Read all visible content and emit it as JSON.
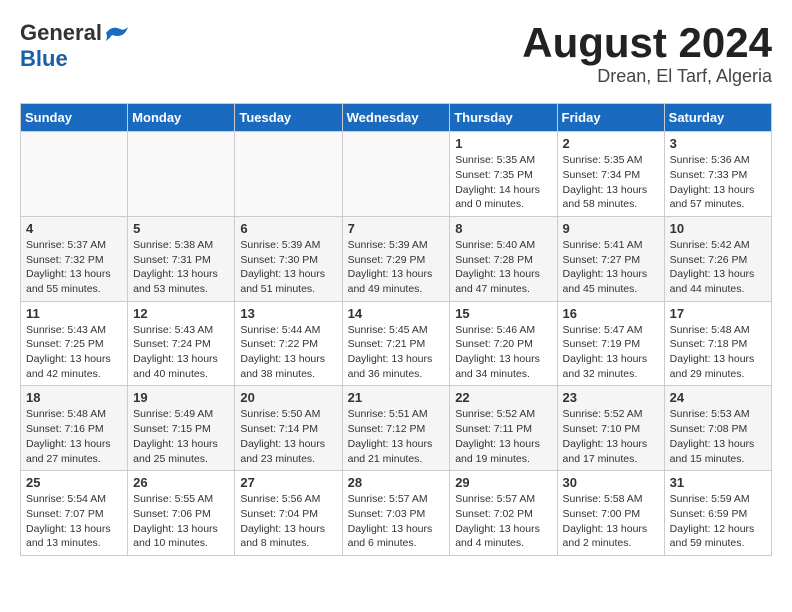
{
  "header": {
    "logo_general": "General",
    "logo_blue": "Blue",
    "month_title": "August 2024",
    "location": "Drean, El Tarf, Algeria"
  },
  "calendar": {
    "days_of_week": [
      "Sunday",
      "Monday",
      "Tuesday",
      "Wednesday",
      "Thursday",
      "Friday",
      "Saturday"
    ],
    "weeks": [
      [
        {
          "day": "",
          "info": ""
        },
        {
          "day": "",
          "info": ""
        },
        {
          "day": "",
          "info": ""
        },
        {
          "day": "",
          "info": ""
        },
        {
          "day": "1",
          "info": "Sunrise: 5:35 AM\nSunset: 7:35 PM\nDaylight: 14 hours\nand 0 minutes."
        },
        {
          "day": "2",
          "info": "Sunrise: 5:35 AM\nSunset: 7:34 PM\nDaylight: 13 hours\nand 58 minutes."
        },
        {
          "day": "3",
          "info": "Sunrise: 5:36 AM\nSunset: 7:33 PM\nDaylight: 13 hours\nand 57 minutes."
        }
      ],
      [
        {
          "day": "4",
          "info": "Sunrise: 5:37 AM\nSunset: 7:32 PM\nDaylight: 13 hours\nand 55 minutes."
        },
        {
          "day": "5",
          "info": "Sunrise: 5:38 AM\nSunset: 7:31 PM\nDaylight: 13 hours\nand 53 minutes."
        },
        {
          "day": "6",
          "info": "Sunrise: 5:39 AM\nSunset: 7:30 PM\nDaylight: 13 hours\nand 51 minutes."
        },
        {
          "day": "7",
          "info": "Sunrise: 5:39 AM\nSunset: 7:29 PM\nDaylight: 13 hours\nand 49 minutes."
        },
        {
          "day": "8",
          "info": "Sunrise: 5:40 AM\nSunset: 7:28 PM\nDaylight: 13 hours\nand 47 minutes."
        },
        {
          "day": "9",
          "info": "Sunrise: 5:41 AM\nSunset: 7:27 PM\nDaylight: 13 hours\nand 45 minutes."
        },
        {
          "day": "10",
          "info": "Sunrise: 5:42 AM\nSunset: 7:26 PM\nDaylight: 13 hours\nand 44 minutes."
        }
      ],
      [
        {
          "day": "11",
          "info": "Sunrise: 5:43 AM\nSunset: 7:25 PM\nDaylight: 13 hours\nand 42 minutes."
        },
        {
          "day": "12",
          "info": "Sunrise: 5:43 AM\nSunset: 7:24 PM\nDaylight: 13 hours\nand 40 minutes."
        },
        {
          "day": "13",
          "info": "Sunrise: 5:44 AM\nSunset: 7:22 PM\nDaylight: 13 hours\nand 38 minutes."
        },
        {
          "day": "14",
          "info": "Sunrise: 5:45 AM\nSunset: 7:21 PM\nDaylight: 13 hours\nand 36 minutes."
        },
        {
          "day": "15",
          "info": "Sunrise: 5:46 AM\nSunset: 7:20 PM\nDaylight: 13 hours\nand 34 minutes."
        },
        {
          "day": "16",
          "info": "Sunrise: 5:47 AM\nSunset: 7:19 PM\nDaylight: 13 hours\nand 32 minutes."
        },
        {
          "day": "17",
          "info": "Sunrise: 5:48 AM\nSunset: 7:18 PM\nDaylight: 13 hours\nand 29 minutes."
        }
      ],
      [
        {
          "day": "18",
          "info": "Sunrise: 5:48 AM\nSunset: 7:16 PM\nDaylight: 13 hours\nand 27 minutes."
        },
        {
          "day": "19",
          "info": "Sunrise: 5:49 AM\nSunset: 7:15 PM\nDaylight: 13 hours\nand 25 minutes."
        },
        {
          "day": "20",
          "info": "Sunrise: 5:50 AM\nSunset: 7:14 PM\nDaylight: 13 hours\nand 23 minutes."
        },
        {
          "day": "21",
          "info": "Sunrise: 5:51 AM\nSunset: 7:12 PM\nDaylight: 13 hours\nand 21 minutes."
        },
        {
          "day": "22",
          "info": "Sunrise: 5:52 AM\nSunset: 7:11 PM\nDaylight: 13 hours\nand 19 minutes."
        },
        {
          "day": "23",
          "info": "Sunrise: 5:52 AM\nSunset: 7:10 PM\nDaylight: 13 hours\nand 17 minutes."
        },
        {
          "day": "24",
          "info": "Sunrise: 5:53 AM\nSunset: 7:08 PM\nDaylight: 13 hours\nand 15 minutes."
        }
      ],
      [
        {
          "day": "25",
          "info": "Sunrise: 5:54 AM\nSunset: 7:07 PM\nDaylight: 13 hours\nand 13 minutes."
        },
        {
          "day": "26",
          "info": "Sunrise: 5:55 AM\nSunset: 7:06 PM\nDaylight: 13 hours\nand 10 minutes."
        },
        {
          "day": "27",
          "info": "Sunrise: 5:56 AM\nSunset: 7:04 PM\nDaylight: 13 hours\nand 8 minutes."
        },
        {
          "day": "28",
          "info": "Sunrise: 5:57 AM\nSunset: 7:03 PM\nDaylight: 13 hours\nand 6 minutes."
        },
        {
          "day": "29",
          "info": "Sunrise: 5:57 AM\nSunset: 7:02 PM\nDaylight: 13 hours\nand 4 minutes."
        },
        {
          "day": "30",
          "info": "Sunrise: 5:58 AM\nSunset: 7:00 PM\nDaylight: 13 hours\nand 2 minutes."
        },
        {
          "day": "31",
          "info": "Sunrise: 5:59 AM\nSunset: 6:59 PM\nDaylight: 12 hours\nand 59 minutes."
        }
      ]
    ]
  }
}
